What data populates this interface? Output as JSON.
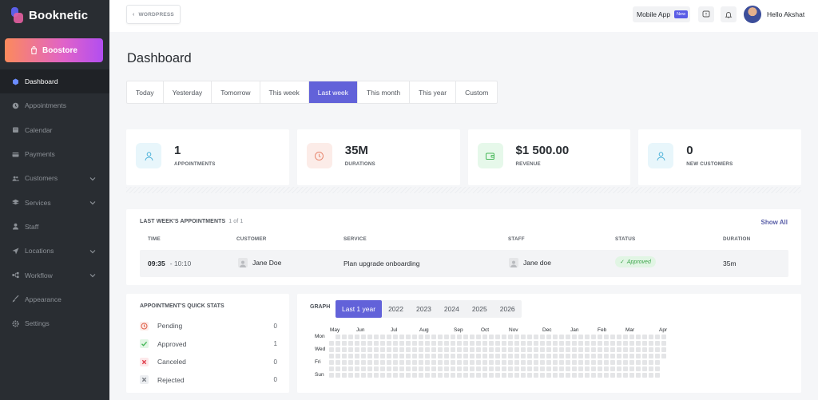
{
  "brand": {
    "name": "Booknetic"
  },
  "sidebar": {
    "boostore": "Boostore",
    "items": [
      {
        "label": "Dashboard",
        "icon": "cube-icon",
        "active": true,
        "chevron": false
      },
      {
        "label": "Appointments",
        "icon": "clock-icon",
        "active": false,
        "chevron": false
      },
      {
        "label": "Calendar",
        "icon": "calendar-icon",
        "active": false,
        "chevron": false
      },
      {
        "label": "Payments",
        "icon": "credit-card-icon",
        "active": false,
        "chevron": false
      },
      {
        "label": "Customers",
        "icon": "users-icon",
        "active": false,
        "chevron": true
      },
      {
        "label": "Services",
        "icon": "layers-icon",
        "active": false,
        "chevron": true
      },
      {
        "label": "Staff",
        "icon": "user-icon",
        "active": false,
        "chevron": false
      },
      {
        "label": "Locations",
        "icon": "location-arrow-icon",
        "active": false,
        "chevron": true
      },
      {
        "label": "Workflow",
        "icon": "workflow-icon",
        "active": false,
        "chevron": true
      },
      {
        "label": "Appearance",
        "icon": "brush-icon",
        "active": false,
        "chevron": false
      },
      {
        "label": "Settings",
        "icon": "gear-icon",
        "active": false,
        "chevron": false
      }
    ]
  },
  "topbar": {
    "back_label": "WORDPRESS",
    "mobile_app": "Mobile App",
    "new_badge": "New",
    "user_greeting": "Hello Akshat"
  },
  "page": {
    "title": "Dashboard"
  },
  "tabs": [
    "Today",
    "Yesterday",
    "Tomorrow",
    "This week",
    "Last week",
    "This month",
    "This year",
    "Custom"
  ],
  "active_tab": "Last week",
  "stats": [
    {
      "value": "1",
      "label": "APPOINTMENTS",
      "icon": "user-icon",
      "bg": "#e8f6fb",
      "color": "#4ab1d9"
    },
    {
      "value": "35M",
      "label": "DURATIONS",
      "icon": "clock-icon",
      "bg": "#fcece8",
      "color": "#e88870"
    },
    {
      "value": "$1 500.00",
      "label": "REVENUE",
      "icon": "wallet-icon",
      "bg": "#e6f8ea",
      "color": "#48b85a"
    },
    {
      "value": "0",
      "label": "NEW CUSTOMERS",
      "icon": "user-icon",
      "bg": "#e8f6fb",
      "color": "#4ab1d9"
    }
  ],
  "appointments": {
    "title": "LAST WEEK'S APPOINTMENTS",
    "count": "1 of 1",
    "show_all": "Show All",
    "columns": [
      "TIME",
      "CUSTOMER",
      "SERVICE",
      "STAFF",
      "STATUS",
      "DURATION"
    ],
    "rows": [
      {
        "time_start": "09:35",
        "time_end": "- 10:10",
        "customer": "Jane Doe",
        "service": "Plan upgrade onboarding",
        "staff": "Jane doe",
        "status": "Approved",
        "duration": "35m"
      }
    ]
  },
  "quick_stats": {
    "title": "APPOINTMENT'S QUICK STATS",
    "items": [
      {
        "label": "Pending",
        "value": "0",
        "icon": "clock-icon",
        "bg": "#fcece8",
        "color": "#e0604a"
      },
      {
        "label": "Approved",
        "value": "1",
        "icon": "check-icon",
        "bg": "#e2f6e5",
        "color": "#48b85a"
      },
      {
        "label": "Canceled",
        "value": "0",
        "icon": "x-icon",
        "bg": "#fde8ea",
        "color": "#e0404e"
      },
      {
        "label": "Rejected",
        "value": "0",
        "icon": "x-icon",
        "bg": "#eceef1",
        "color": "#7a7f86"
      }
    ]
  },
  "graph": {
    "title": "GRAPH",
    "years": [
      "Last 1 year",
      "2022",
      "2023",
      "2024",
      "2025",
      "2026"
    ],
    "active_year": "Last 1 year",
    "months": [
      "May",
      "Jun",
      "Jul",
      "Aug",
      "Sep",
      "Oct",
      "Nov",
      "Dec",
      "Jan",
      "Feb",
      "Mar",
      "Apr"
    ],
    "days": [
      "Mon",
      "Wed",
      "Fri",
      "Sun"
    ]
  }
}
